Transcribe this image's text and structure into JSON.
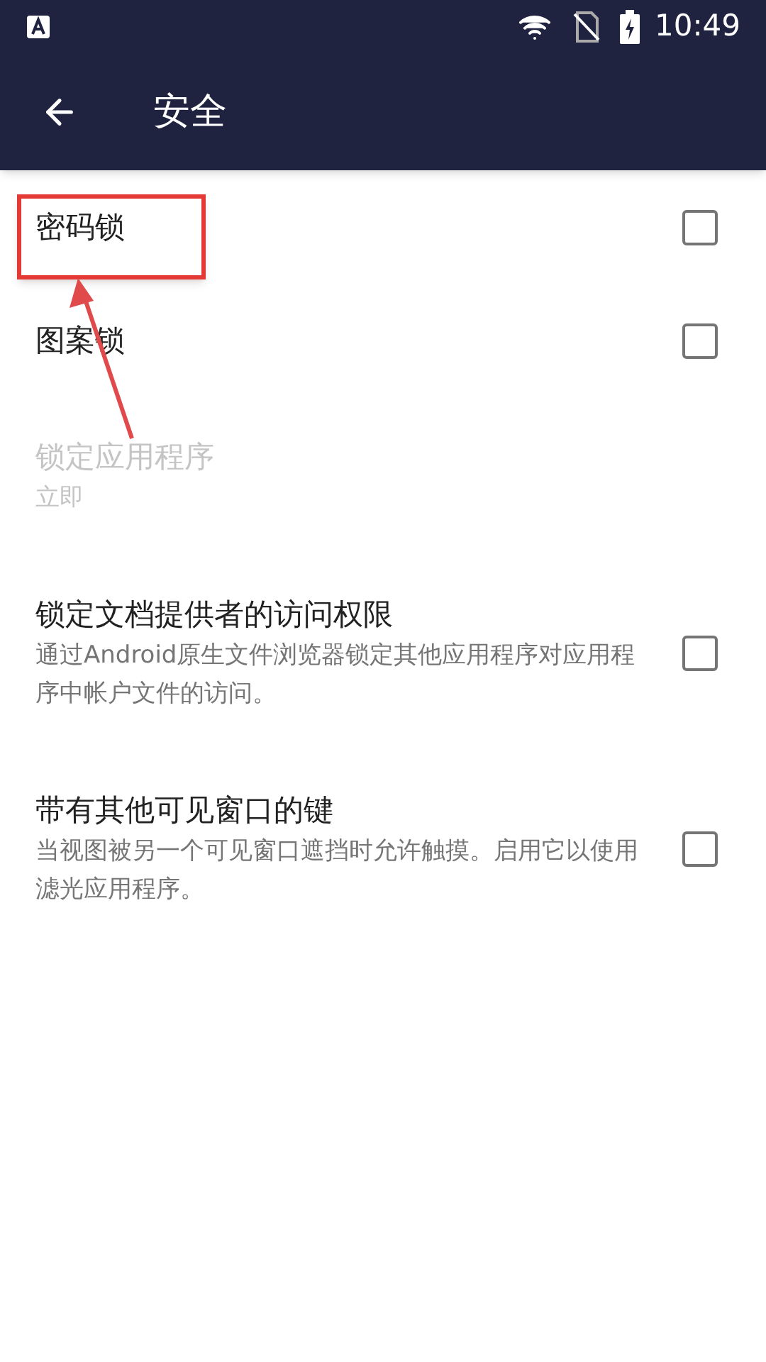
{
  "status_bar": {
    "time": "10:49"
  },
  "app_bar": {
    "title": "安全"
  },
  "settings": [
    {
      "kind": "checkbox",
      "title": "密码锁",
      "checked": false,
      "disabled": false
    },
    {
      "kind": "checkbox",
      "title": "图案锁",
      "checked": false,
      "disabled": false
    },
    {
      "kind": "plain",
      "title": "锁定应用程序",
      "summary": "立即",
      "disabled": true
    },
    {
      "kind": "checkbox",
      "title": "锁定文档提供者的访问权限",
      "summary": "通过Android原生文件浏览器锁定其他应用程序对应用程序中帐户文件的访问。",
      "checked": false,
      "disabled": false
    },
    {
      "kind": "checkbox",
      "title": "带有其他可见窗口的键",
      "summary": "当视图被另一个可见窗口遮挡时允许触摸。启用它以使用滤光应用程序。",
      "checked": false,
      "disabled": false
    }
  ]
}
